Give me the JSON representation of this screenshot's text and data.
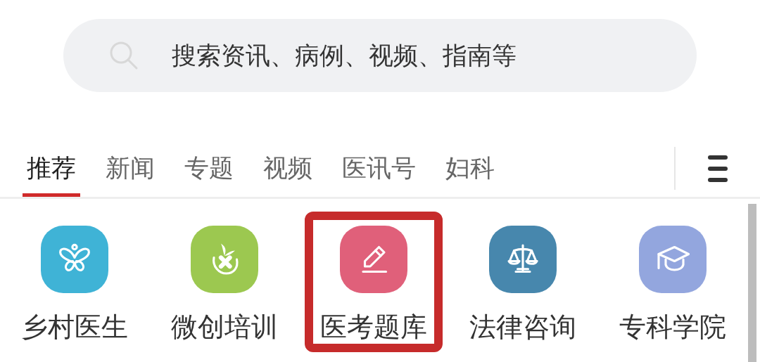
{
  "search": {
    "placeholder": "搜索资讯、病例、视频、指南等"
  },
  "tabs": [
    {
      "label": "推荐",
      "selected": true
    },
    {
      "label": "新闻",
      "selected": false
    },
    {
      "label": "专题",
      "selected": false
    },
    {
      "label": "视频",
      "selected": false
    },
    {
      "label": "医讯号",
      "selected": false
    },
    {
      "label": "妇科",
      "selected": false
    }
  ],
  "shortcuts": [
    {
      "label": "乡村医生",
      "kind": "butterfly",
      "color": "#3fb3d6",
      "highlighted": false
    },
    {
      "label": "微创培训",
      "kind": "leaf",
      "color": "#9cc850",
      "highlighted": false
    },
    {
      "label": "医考题库",
      "kind": "pencil",
      "color": "#e0607a",
      "highlighted": true
    },
    {
      "label": "法律咨询",
      "kind": "scales",
      "color": "#4787ad",
      "highlighted": false
    },
    {
      "label": "专科学院",
      "kind": "cap",
      "color": "#93a6de",
      "highlighted": false
    }
  ]
}
